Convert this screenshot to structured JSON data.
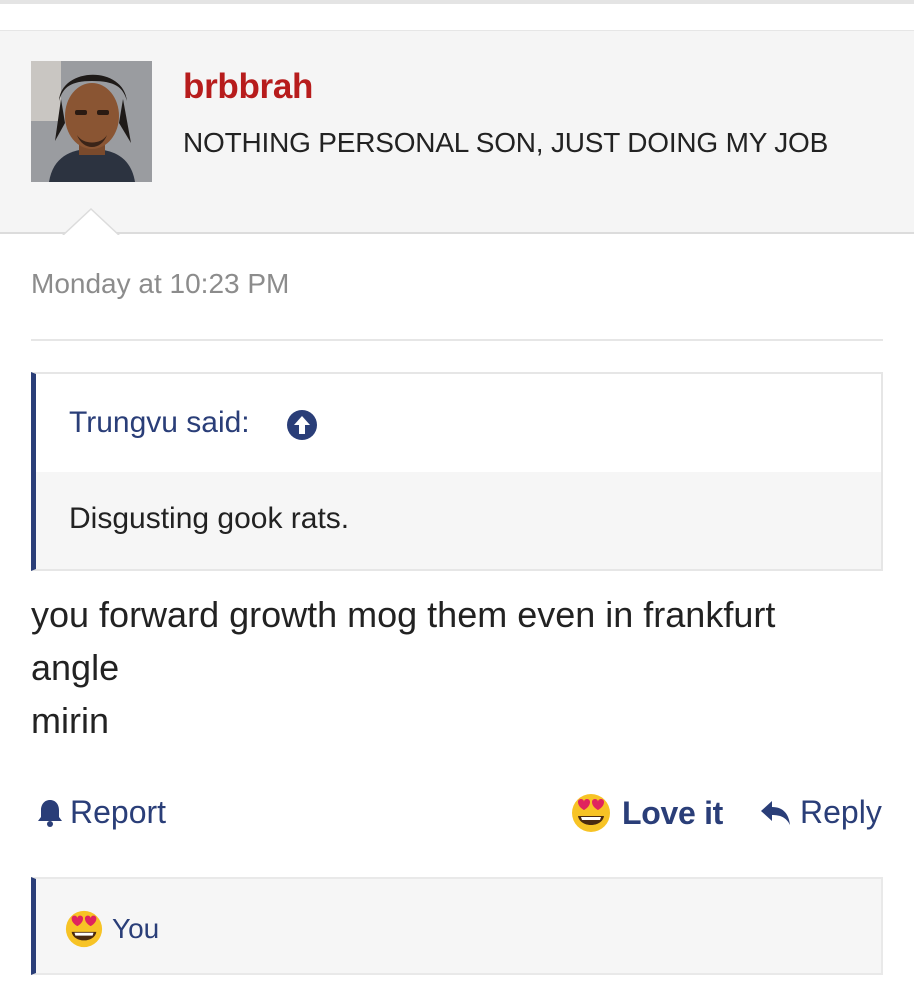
{
  "post": {
    "username": "brbbrah",
    "user_title": "NOTHING PERSONAL SON, JUST DOING MY JOB",
    "timestamp": "Monday at 10:23 PM",
    "quote": {
      "author_label": "Trungvu said:",
      "text": "Disgusting gook rats."
    },
    "message_lines": [
      "you forward growth mog them even in frankfurt",
      "angle",
      "mirin"
    ]
  },
  "actions": {
    "report_label": "Report",
    "love_label": "Love it",
    "reply_label": "Reply"
  },
  "reactions": {
    "label": "You",
    "icon": "heart-eyes-emoji-icon"
  },
  "colors": {
    "username": "#b71c1c",
    "accent": "#2a3e78",
    "muted": "#8c8c8c"
  }
}
